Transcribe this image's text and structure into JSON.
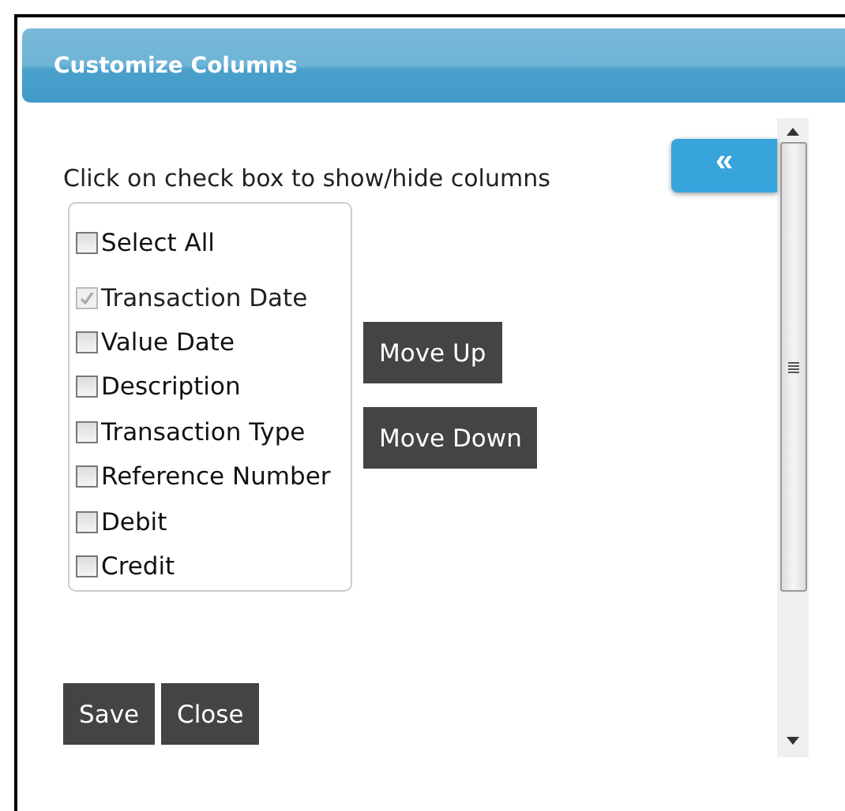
{
  "dialog": {
    "title": "Customize Columns"
  },
  "collapse_button": {
    "label": "«"
  },
  "instruction": "Click on check box to show/hide columns",
  "select_all": {
    "label": "Select All",
    "checked": false,
    "disabled": false
  },
  "columns": [
    {
      "label": "Transaction Date",
      "checked": true,
      "disabled": true
    },
    {
      "label": "Value Date",
      "checked": false,
      "disabled": false
    },
    {
      "label": "Description",
      "checked": false,
      "disabled": false
    },
    {
      "label": "Transaction Type",
      "checked": false,
      "disabled": false
    },
    {
      "label": "Reference Number",
      "checked": false,
      "disabled": false
    },
    {
      "label": "Debit",
      "checked": false,
      "disabled": false
    },
    {
      "label": "Credit",
      "checked": false,
      "disabled": false
    }
  ],
  "move_buttons": [
    "Move Up",
    "Move Down"
  ],
  "footer_buttons": [
    "Save",
    "Close"
  ]
}
